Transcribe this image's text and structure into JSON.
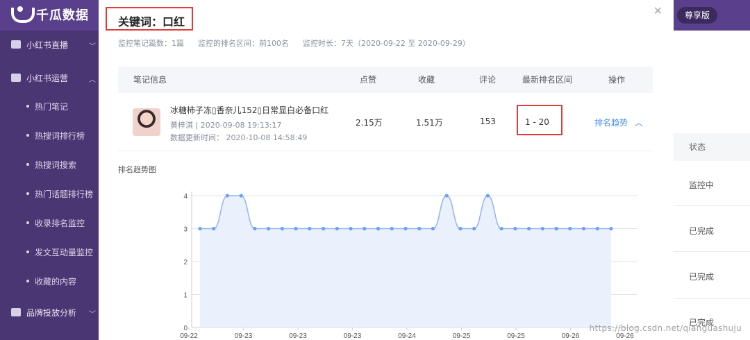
{
  "app": {
    "brand": "千瓜数据",
    "vip_label": "尊享版"
  },
  "sidebar": {
    "groups": [
      {
        "label": "小红书直播"
      },
      {
        "label": "小红书运营"
      },
      {
        "label": "品牌投放分析"
      }
    ],
    "items": [
      {
        "label": "热门笔记"
      },
      {
        "label": "热搜词排行榜"
      },
      {
        "label": "热搜词搜索"
      },
      {
        "label": "热门话题排行榜"
      },
      {
        "label": "收录排名监控"
      },
      {
        "label": "发文互动量监控"
      },
      {
        "label": "收藏的内容"
      }
    ]
  },
  "right_panel": {
    "header": "状态",
    "rows": [
      "监控中",
      "已完成",
      "已完成",
      "已完成"
    ]
  },
  "modal": {
    "title": "关键词：口红",
    "meta": {
      "notes": "监控笔记篇数：1篇",
      "range": "监控的排名区间：前100名",
      "duration": "监控时长：7天（2020-09-22 至 2020-09-29）"
    },
    "table": {
      "headers": [
        "笔记信息",
        "点赞",
        "收藏",
        "评论",
        "最新排名区间",
        "操作"
      ],
      "row": {
        "title": "冰糖柿子冻▯香奈儿152▯日常显白必备口红",
        "author_time": "黄梓淇 | 2020-09-08 19:13:17",
        "update_time": "数据更新时间：  2020-10-08 14:58:49",
        "likes": "2.15万",
        "favorites": "1.51万",
        "comments": "153",
        "rank_range": "1 - 20",
        "action": "排名趋势"
      }
    },
    "chart_title": "排名趋势图"
  },
  "watermark": "https://blog.csdn.net/qianguashuju",
  "chart_data": {
    "type": "area",
    "yticks": [
      "0",
      "1",
      "2",
      "3",
      "4"
    ],
    "ylim": [
      0,
      4
    ],
    "xtick_labels": [
      "09-22",
      "09-23",
      "09-23",
      "09-23",
      "09-24",
      "09-25",
      "09-25",
      "09-26",
      "09-26"
    ],
    "values": [
      3,
      3,
      4,
      4,
      3,
      3,
      3,
      3,
      3,
      3,
      3,
      3,
      3,
      3,
      3,
      3,
      3,
      3,
      4,
      3,
      3,
      4,
      3,
      3,
      3,
      3,
      3,
      3,
      3,
      3,
      3
    ],
    "colors": {
      "line": "#8fb4f5",
      "fill": "#e8effd",
      "point": "#6f9ff2"
    }
  }
}
